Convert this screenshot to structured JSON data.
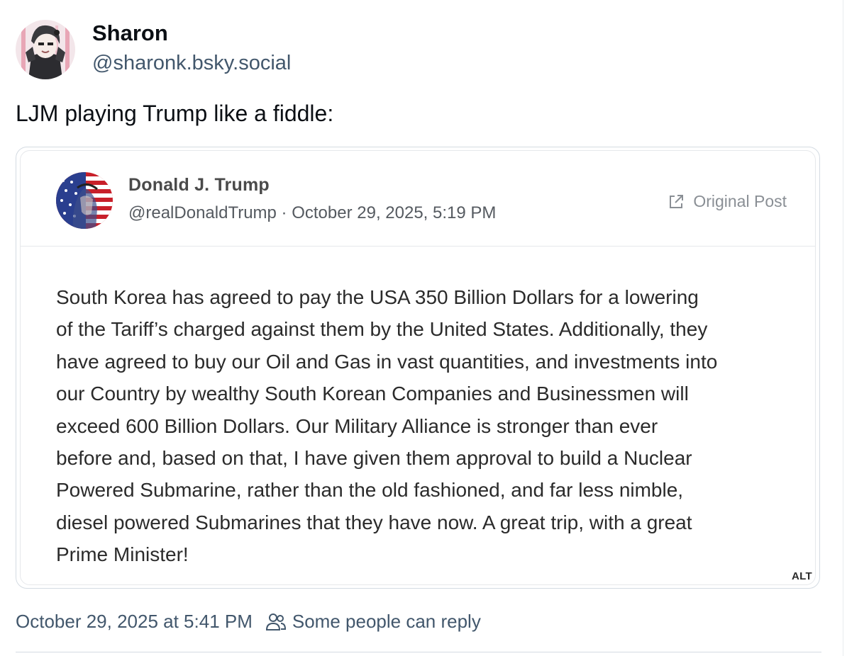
{
  "author": {
    "name": "Sharon",
    "handle": "@sharonk.bsky.social",
    "avatar_icon": "anime-character-avatar"
  },
  "post": {
    "text": "LJM playing Trump like a fiddle:"
  },
  "embed": {
    "author_name": "Donald J. Trump",
    "author_meta": "@realDonaldTrump · October 29, 2025, 5:19 PM",
    "avatar_icon": "flag-portrait-avatar",
    "original_post_label": "Original Post",
    "original_post_icon": "external-link-icon",
    "body_lines": [
      "South Korea has agreed to pay the USA 350 Billion Dollars for a lowering",
      "of the Tariff’s charged against them by the United States. Additionally, they",
      "have agreed to buy our Oil and Gas in vast quantities, and investments into",
      "our Country by wealthy South Korean Companies and Businessmen will",
      "exceed 600 Billion Dollars. Our Military Alliance is stronger than ever",
      "before and, based on that, I have given them approval to build a Nuclear",
      "Powered Submarine, rather than the old fashioned, and far less nimble,",
      "diesel powered Submarines that they have now. A great trip, with a great",
      "Prime Minister!"
    ],
    "alt_label": "ALT"
  },
  "footer": {
    "timestamp": "October 29, 2025 at 5:41 PM",
    "reply_setting": "Some people can reply",
    "reply_icon": "people-icon"
  },
  "colors": {
    "text_primary": "#0b0f14",
    "text_secondary": "#42576c",
    "border": "#d4dbe2"
  }
}
